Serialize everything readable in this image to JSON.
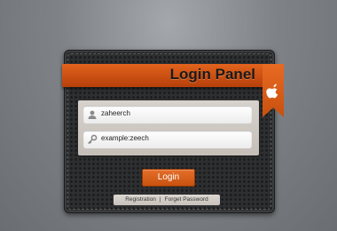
{
  "panel": {
    "title": "Login Panel",
    "brand_icon": "apple-icon",
    "accent_color": "#d85a16"
  },
  "form": {
    "username_value": "zaheerch",
    "username_icon": "user-icon",
    "password_value": "example:zeech",
    "password_icon": "key-icon"
  },
  "actions": {
    "login_label": "Login"
  },
  "links": {
    "registration": "Registration",
    "separator": "|",
    "forgot": "Forget Password"
  }
}
